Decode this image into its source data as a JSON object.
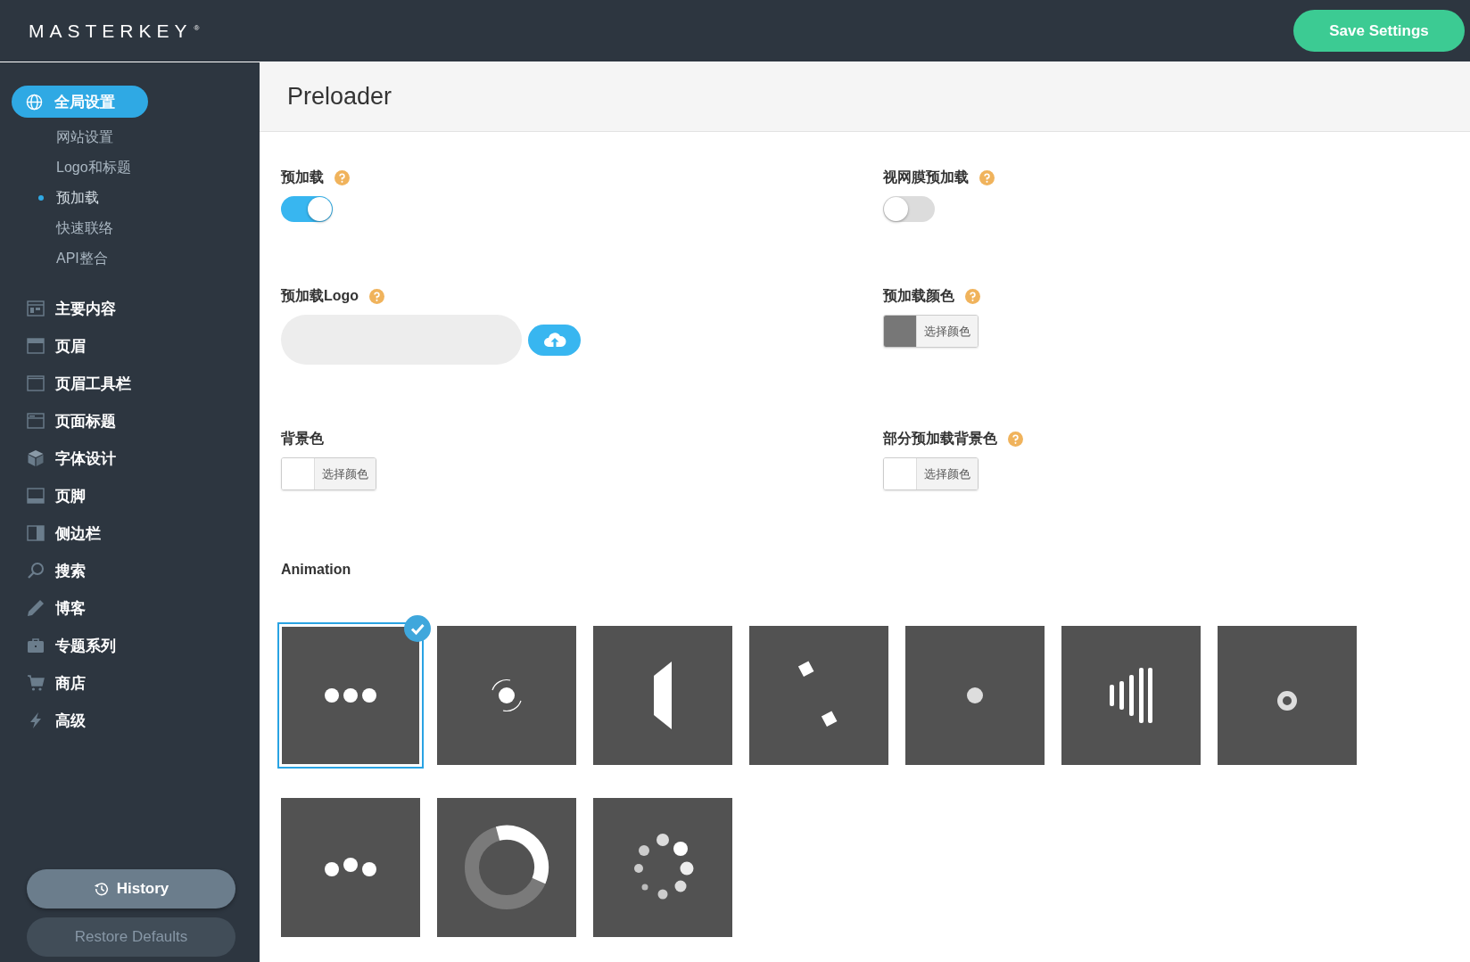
{
  "header": {
    "logo": "MASTERKEY",
    "logo_mark": "®",
    "save_button": "Save Settings"
  },
  "sidebar": {
    "groups": [
      {
        "label": "全局设置",
        "selected": true,
        "children": [
          {
            "label": "网站设置",
            "selected": false
          },
          {
            "label": "Logo和标题",
            "selected": false
          },
          {
            "label": "预加载",
            "selected": true
          },
          {
            "label": "快速联络",
            "selected": false
          },
          {
            "label": "API整合",
            "selected": false
          }
        ]
      }
    ],
    "items": [
      {
        "label": "主要内容"
      },
      {
        "label": "页眉"
      },
      {
        "label": "页眉工具栏"
      },
      {
        "label": "页面标题"
      },
      {
        "label": "字体设计"
      },
      {
        "label": "页脚"
      },
      {
        "label": "侧边栏"
      },
      {
        "label": "搜索"
      },
      {
        "label": "博客"
      },
      {
        "label": "专题系列"
      },
      {
        "label": "商店"
      },
      {
        "label": "高级"
      }
    ],
    "buttons": [
      "History",
      "Restore Defaults"
    ]
  },
  "page": {
    "title": "Preloader",
    "fields": [
      {
        "kind": "toggle",
        "label": "预加载",
        "help": true,
        "on": true
      },
      {
        "kind": "toggle",
        "label": "视网膜预加载",
        "help": true,
        "on": false
      },
      {
        "kind": "upload",
        "label": "预加载Logo",
        "help": true
      },
      {
        "kind": "color",
        "label": "预加载颜色",
        "help": true,
        "color": "#777777",
        "button": "选择颜色"
      },
      {
        "kind": "color",
        "label": "背景色",
        "help": false,
        "color": "#ffffff",
        "button": "选择颜色"
      },
      {
        "kind": "color",
        "label": "部分预加载背景色",
        "help": true,
        "color": "#ffffff",
        "button": "选择颜色"
      }
    ],
    "animation": {
      "label": "Animation",
      "options": [
        {
          "kind": "dots",
          "selected": true
        },
        {
          "kind": "orbit",
          "selected": false
        },
        {
          "kind": "flip",
          "selected": false
        },
        {
          "kind": "squares",
          "selected": false
        },
        {
          "kind": "dot",
          "selected": false
        },
        {
          "kind": "bars",
          "selected": false
        },
        {
          "kind": "ring-dot",
          "selected": false
        },
        {
          "kind": "dots-bounce",
          "selected": false
        },
        {
          "kind": "arc",
          "selected": false
        },
        {
          "kind": "spinner",
          "selected": false
        }
      ]
    }
  }
}
